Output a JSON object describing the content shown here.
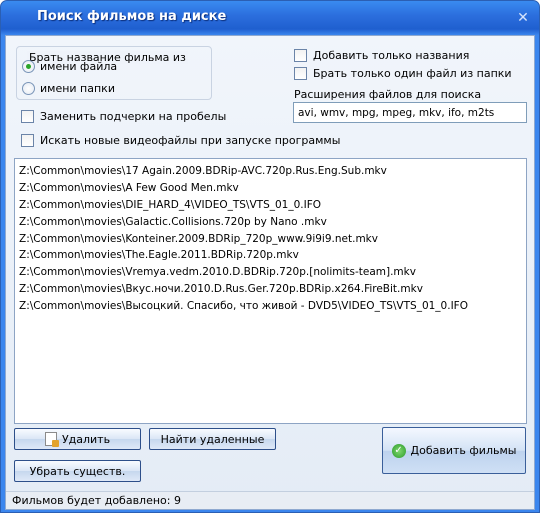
{
  "window": {
    "title": "Поиск фильмов на диске",
    "close_symbol": "✕"
  },
  "options": {
    "group_label": "Брать название фильма из",
    "radio_filename": "имени файла",
    "radio_foldername": "имени папки",
    "selected": "radio_filename",
    "replace_underscores": "Заменить подчерки на пробелы",
    "search_on_startup": "Искать новые видеофайлы при запуске программы",
    "add_names_only": "Добавить только названия",
    "one_file_per_folder": "Брать только один файл из папки",
    "extensions_label": "Расширения файлов для поиска",
    "extensions_value": "avi, wmv, mpg, mpeg, mkv, ifo, m2ts"
  },
  "files": [
    "Z:\\Common\\movies\\17 Again.2009.BDRip-AVC.720p.Rus.Eng.Sub.mkv",
    "Z:\\Common\\movies\\A Few Good Men.mkv",
    "Z:\\Common\\movies\\DIE_HARD_4\\VIDEO_TS\\VTS_01_0.IFO",
    "Z:\\Common\\movies\\Galactic.Collisions.720p by Nano .mkv",
    "Z:\\Common\\movies\\Konteiner.2009.BDRip_720p_www.9i9i9.net.mkv",
    "Z:\\Common\\movies\\The.Eagle.2011.BDRip.720p.mkv",
    "Z:\\Common\\movies\\Vremya.vedm.2010.D.BDRip.720p.[nolimits-team].mkv",
    "Z:\\Common\\movies\\Вкус.ночи.2010.D.Rus.Ger.720p.BDRip.x264.FireBit.mkv",
    "Z:\\Common\\movies\\Высоцкий. Спасибо, что живой - DVD5\\VIDEO_TS\\VTS_01_0.IFO"
  ],
  "buttons": {
    "delete": "Удалить",
    "find_deleted": "Найти удаленные",
    "strip_nouns": "Убрать существ.",
    "add_movies": "Добавить фильмы"
  },
  "status": {
    "text": "Фильмов будет добавлено: 9"
  },
  "icons": {
    "delete_icon": "document-delete-icon",
    "add_icon": "ok-check-icon"
  }
}
